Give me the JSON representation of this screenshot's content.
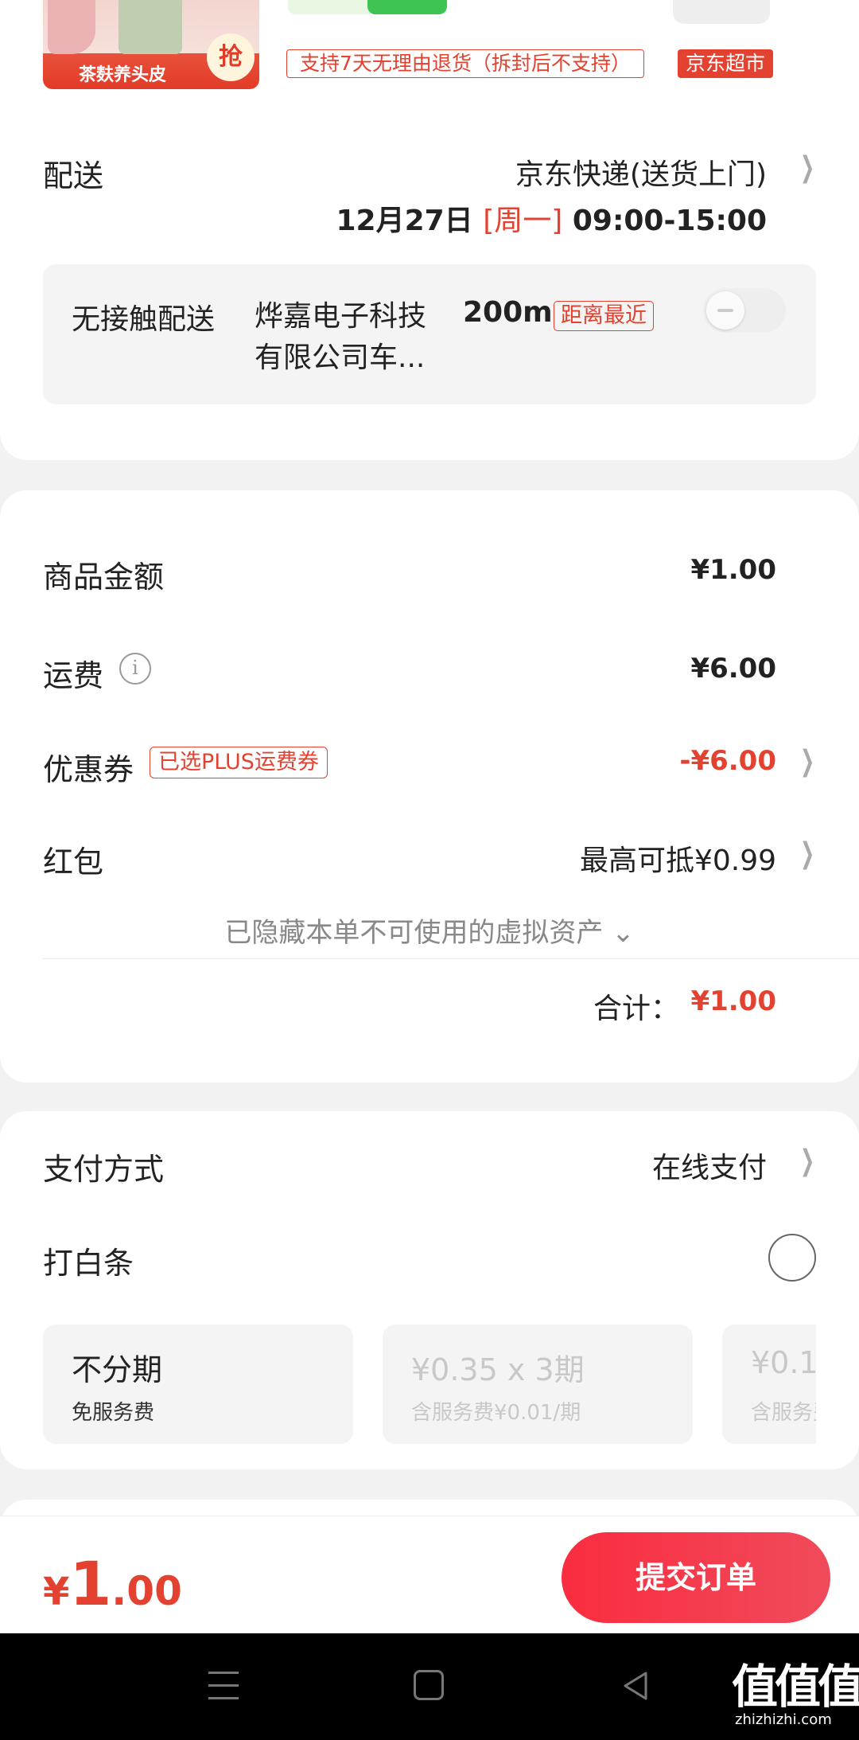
{
  "product": {
    "image_caption": "茶麸养头皮",
    "grab_badge": "抢",
    "return_policy": "支持7天无理由退货（拆封后不支持）",
    "store_badge": "京东超市"
  },
  "delivery": {
    "label": "配送",
    "method": "京东快递(送货上门)",
    "date": "12月27日",
    "weekday": "[周一]",
    "time": "09:00-15:00",
    "contactless": {
      "title": "无接触配送",
      "place": "烨嘉电子科技有限公司车...",
      "distance": "200m",
      "nearest_tag": "距离最近",
      "enabled": false
    }
  },
  "amounts": {
    "goods_label": "商品金额",
    "goods_value": "¥1.00",
    "freight_label": "运费",
    "freight_value": "¥6.00",
    "coupon_label": "优惠券",
    "coupon_tag": "已选PLUS运费券",
    "coupon_value": "-¥6.00",
    "hongbao_label": "红包",
    "hongbao_value": "最高可抵¥0.99",
    "hidden_assets": "已隐藏本单不可使用的虚拟资产 ⌄",
    "total_label": "合计：",
    "total_value": "¥1.00"
  },
  "payment": {
    "label": "支付方式",
    "value": "在线支付",
    "baitiao_label": "打白条",
    "baitiao_selected": false,
    "plans": [
      {
        "title": "不分期",
        "sub": "免服务费"
      },
      {
        "title": "¥0.35 x 3期",
        "sub": "含服务费¥0.01/期"
      },
      {
        "title": "¥0.1",
        "sub": "含服务费"
      }
    ]
  },
  "footer": {
    "price_symbol": "¥",
    "price_int": "1",
    "price_dec": ".00",
    "submit_label": "提交订单"
  },
  "watermark": {
    "main": "值值值",
    "sub": "zhizhizhi.com"
  },
  "colors": {
    "accent": "#e2422f",
    "submit_gradient_start": "#fa2c3f",
    "background": "#f2f2f2"
  }
}
